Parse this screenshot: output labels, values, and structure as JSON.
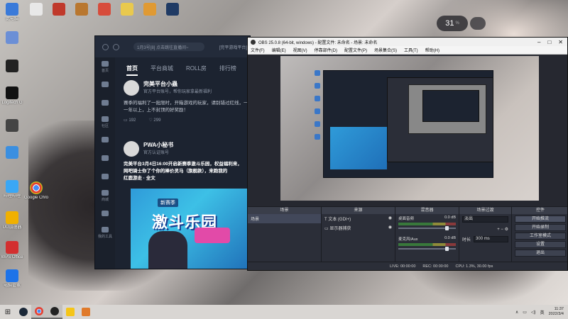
{
  "desktop": {
    "icons_col1": [
      {
        "label": "此电脑",
        "color": "#3a7ad9"
      },
      {
        "label": "",
        "color": "#6b8fd6"
      },
      {
        "label": "",
        "color": "#222222"
      },
      {
        "label": "Logitech G",
        "color": "#111111"
      },
      {
        "label": "",
        "color": "#444444"
      },
      {
        "label": "",
        "color": "#3b8fe0"
      },
      {
        "label": "哔哩哔哩",
        "color": "#3aa7f5"
      },
      {
        "label": "UU加速器",
        "color": "#f0b000"
      },
      {
        "label": "WPS Office",
        "color": "#d32f2f"
      },
      {
        "label": "电脑管家",
        "color": "#1e73e8"
      }
    ],
    "icons_top": [
      {
        "label": "",
        "color": "#e8e8e8"
      },
      {
        "label": "",
        "color": "#c0392b"
      },
      {
        "label": "",
        "color": "#b9772f"
      },
      {
        "label": "",
        "color": "#d74c3b"
      },
      {
        "label": "",
        "color": "#e9c94e"
      },
      {
        "label": "",
        "color": "#e09a34"
      },
      {
        "label": "",
        "color": "#1f3a64"
      }
    ],
    "icon_chrome": {
      "label": "Google Chrome",
      "color": "#e34133"
    },
    "clock_widget": {
      "value": "31",
      "unit": "%"
    }
  },
  "wanmei_window": {
    "search_placeholder": "1月3号[8]   点击跳往直播间~",
    "header_right": "[完平游戏平台]",
    "tabs": [
      "首页",
      "平台商城",
      "ROLL房",
      "排行榜"
    ],
    "sidebar_labels": [
      "首页",
      "",
      "",
      "社区",
      "",
      "",
      "",
      "商城",
      "",
      "我的工具"
    ],
    "post1": {
      "name": "完美平台小蟲",
      "meta": "官方平台账号，帮你玩家拿最新福利",
      "body1": "赛季的福利了一批限时，开箱游戏的玩家，请别错过红线，一但完",
      "body2": "一年以上，上不封顶的好奖励！",
      "likes": "192",
      "comments": "299"
    },
    "post2": {
      "name": "PWA小秘书",
      "meta": "官方认证账号",
      "body1": "完美平台3月4日16:00开启新赛季激斗乐园，权益福利来，",
      "body2": "网吧骑士你了个你的棒价灵马（旗舰款），来跑我的",
      "body3": "红鹿游走 · 全文"
    },
    "banner": {
      "tag": "新赛季",
      "title": "激斗乐园"
    }
  },
  "obs": {
    "title": "OBS 25.0.8 (64-bit, windows) - 配置文件: 未命名 - 场景: 未命名",
    "menu": [
      "文件(F)",
      "编辑(E)",
      "视图(V)",
      "停靠部件(D)",
      "配置文件(P)",
      "场景集合(S)",
      "工具(T)",
      "帮助(H)"
    ],
    "docks": {
      "scenes": {
        "header": "场景",
        "items": [
          "场景"
        ]
      },
      "sources": {
        "header": "来源",
        "items": [
          "文本 (GDI+)",
          "显示器捕获"
        ]
      },
      "mixer": {
        "header": "混音器",
        "channels": [
          {
            "name": "桌面音频",
            "db": "0.0 dB"
          },
          {
            "name": "麦克风/Aux",
            "db": "0.0 dB"
          }
        ]
      },
      "transitions": {
        "header": "场景过渡",
        "type": "淡出",
        "duration_label": "时长",
        "duration_value": "300 ms"
      },
      "controls": {
        "header": "控件",
        "buttons": [
          "开始推流",
          "开始录制",
          "工作室模式",
          "设置",
          "退出"
        ]
      }
    },
    "status": {
      "live": "LIVE: 00:00:00",
      "rec": "REC: 00:00:00",
      "cpu": "CPU: 1.3%, 30.00 fps"
    }
  },
  "taskbar": {
    "start_label": "⊞",
    "apps": [
      "Steam",
      "Google Chrome",
      "OBS",
      "哔哩哔哩",
      "UU加速器"
    ],
    "time": "11:37",
    "date": "2022/3/4"
  }
}
